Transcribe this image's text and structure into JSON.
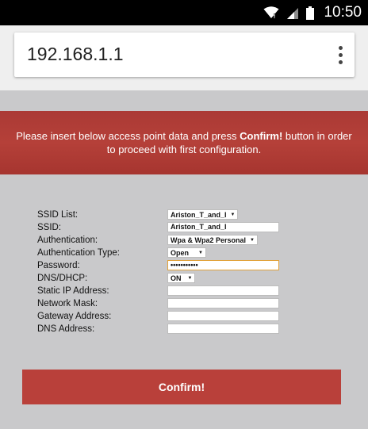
{
  "status_bar": {
    "time": "10:50",
    "icons": [
      "wifi-icon",
      "signal-icon",
      "battery-icon"
    ]
  },
  "browser": {
    "url": "192.168.1.1",
    "menu_icon": "more-vert-icon"
  },
  "banner": {
    "text_before": "Please insert below access point data and press ",
    "text_bold": "Confirm!",
    "text_after": " button in order to proceed with first configuration."
  },
  "form": {
    "ssid_list": {
      "label": "SSID List:",
      "value": "Ariston_T_and_I"
    },
    "ssid": {
      "label": "SSID:",
      "value": "Ariston_T_and_I"
    },
    "authentication": {
      "label": "Authentication:",
      "value": "Wpa & Wpa2 Personal"
    },
    "authentication_type": {
      "label": "Authentication Type:",
      "value": "Open"
    },
    "password": {
      "label": "Password:",
      "value": "•••••••••••"
    },
    "dns_dhcp": {
      "label": "DNS/DHCP:",
      "value": "ON"
    },
    "static_ip": {
      "label": "Static IP Address:",
      "value": ""
    },
    "network_mask": {
      "label": "Network Mask:",
      "value": ""
    },
    "gateway": {
      "label": "Gateway Address:",
      "value": ""
    },
    "dns_address": {
      "label": "DNS Address:",
      "value": ""
    }
  },
  "confirm_button": {
    "label": "Confirm!"
  },
  "colors": {
    "banner": "#b53d37",
    "button": "#b9403a",
    "page_bg": "#c9c9cb",
    "status_bar": "#000000"
  }
}
